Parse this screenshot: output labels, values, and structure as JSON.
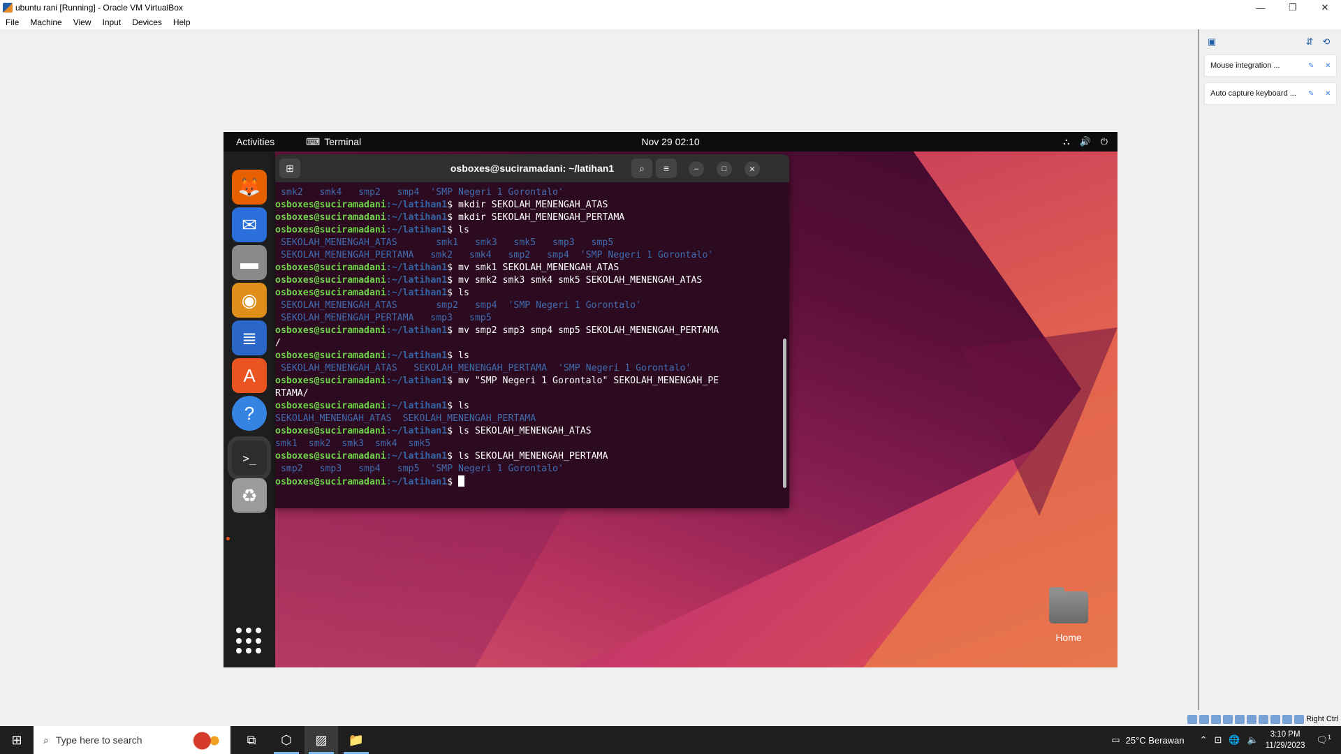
{
  "window": {
    "title": "ubuntu rani [Running] - Oracle VM VirtualBox",
    "min_icon": "minimize-icon",
    "max_icon": "restore-icon",
    "close_icon": "close-icon"
  },
  "menubar": [
    "File",
    "Machine",
    "View",
    "Input",
    "Devices",
    "Help"
  ],
  "ubuntu": {
    "activities": "Activities",
    "app_name": "Terminal",
    "clock": "Nov 29  02:10",
    "home_label": "Home"
  },
  "terminal": {
    "title": "osboxes@suciramadani: ~/latihan1",
    "prompt_user": "osboxes@suciramadani",
    "prompt_path": ":~/latihan1",
    "lines": [
      {
        "kind": "out",
        "text": " smk2   smk4   smp2   smp4  'SMP Negeri 1 Gorontalo'"
      },
      {
        "kind": "cmd",
        "text": "mkdir SEKOLAH_MENENGAH_ATAS"
      },
      {
        "kind": "cmd",
        "text": "mkdir SEKOLAH_MENENGAH_PERTAMA"
      },
      {
        "kind": "cmd",
        "text": "ls"
      },
      {
        "kind": "out",
        "text": " SEKOLAH_MENENGAH_ATAS       smk1   smk3   smk5   smp3   smp5"
      },
      {
        "kind": "out",
        "text": " SEKOLAH_MENENGAH_PERTAMA   smk2   smk4   smp2   smp4  'SMP Negeri 1 Gorontalo'"
      },
      {
        "kind": "cmd",
        "text": "mv smk1 SEKOLAH_MENENGAH_ATAS"
      },
      {
        "kind": "cmd",
        "text": "mv smk2 smk3 smk4 smk5 SEKOLAH_MENENGAH_ATAS"
      },
      {
        "kind": "cmd",
        "text": "ls"
      },
      {
        "kind": "out",
        "text": " SEKOLAH_MENENGAH_ATAS       smp2   smp4  'SMP Negeri 1 Gorontalo'"
      },
      {
        "kind": "out",
        "text": " SEKOLAH_MENENGAH_PERTAMA   smp3   smp5"
      },
      {
        "kind": "cmd",
        "text": "mv smp2 smp3 smp4 smp5 SEKOLAH_MENENGAH_PERTAMA"
      },
      {
        "kind": "plain",
        "text": "/"
      },
      {
        "kind": "cmd",
        "text": "ls"
      },
      {
        "kind": "out",
        "text": " SEKOLAH_MENENGAH_ATAS   SEKOLAH_MENENGAH_PERTAMA  'SMP Negeri 1 Gorontalo'"
      },
      {
        "kind": "cmd",
        "text": "mv \"SMP Negeri 1 Gorontalo\" SEKOLAH_MENENGAH_PE"
      },
      {
        "kind": "plain",
        "text": "RTAMA/"
      },
      {
        "kind": "cmd",
        "text": "ls"
      },
      {
        "kind": "out",
        "text": "SEKOLAH_MENENGAH_ATAS  SEKOLAH_MENENGAH_PERTAMA"
      },
      {
        "kind": "cmd",
        "text": "ls SEKOLAH_MENENGAH_ATAS"
      },
      {
        "kind": "out",
        "text": "smk1  smk2  smk3  smk4  smk5"
      },
      {
        "kind": "cmd",
        "text": "ls SEKOLAH_MENENGAH_PERTAMA"
      },
      {
        "kind": "out",
        "text": " smp2   smp3   smp4   smp5  'SMP Negeri 1 Gorontalo'"
      },
      {
        "kind": "cursor",
        "text": ""
      }
    ]
  },
  "dock": [
    {
      "name": "firefox-icon",
      "glyph": "🦊",
      "bg": "#e66000"
    },
    {
      "name": "thunderbird-icon",
      "glyph": "✉",
      "bg": "#2a6fdb"
    },
    {
      "name": "files-icon",
      "glyph": "▬",
      "bg": "#8a8a8a"
    },
    {
      "name": "rhythmbox-icon",
      "glyph": "◉",
      "bg": "#e08e1a"
    },
    {
      "name": "writer-icon",
      "glyph": "≣",
      "bg": "#2a67c9"
    },
    {
      "name": "software-icon",
      "glyph": "A",
      "bg": "#e95420"
    },
    {
      "name": "help-icon",
      "glyph": "?",
      "bg": "#3584e4"
    },
    {
      "name": "terminal-icon",
      "glyph": ">_",
      "bg": "#2d2d2d"
    },
    {
      "name": "trash-icon",
      "glyph": "♻",
      "bg": "#9b9b9b"
    }
  ],
  "panel": {
    "notifications": [
      "Mouse integration ...",
      "Auto capture keyboard ..."
    ],
    "host_key": "Right Ctrl"
  },
  "taskbar": {
    "search_placeholder": "Type here to search",
    "weather": "25°C  Berawan",
    "time": "3:10 PM",
    "date": "11/29/2023",
    "notif_count": "1"
  }
}
